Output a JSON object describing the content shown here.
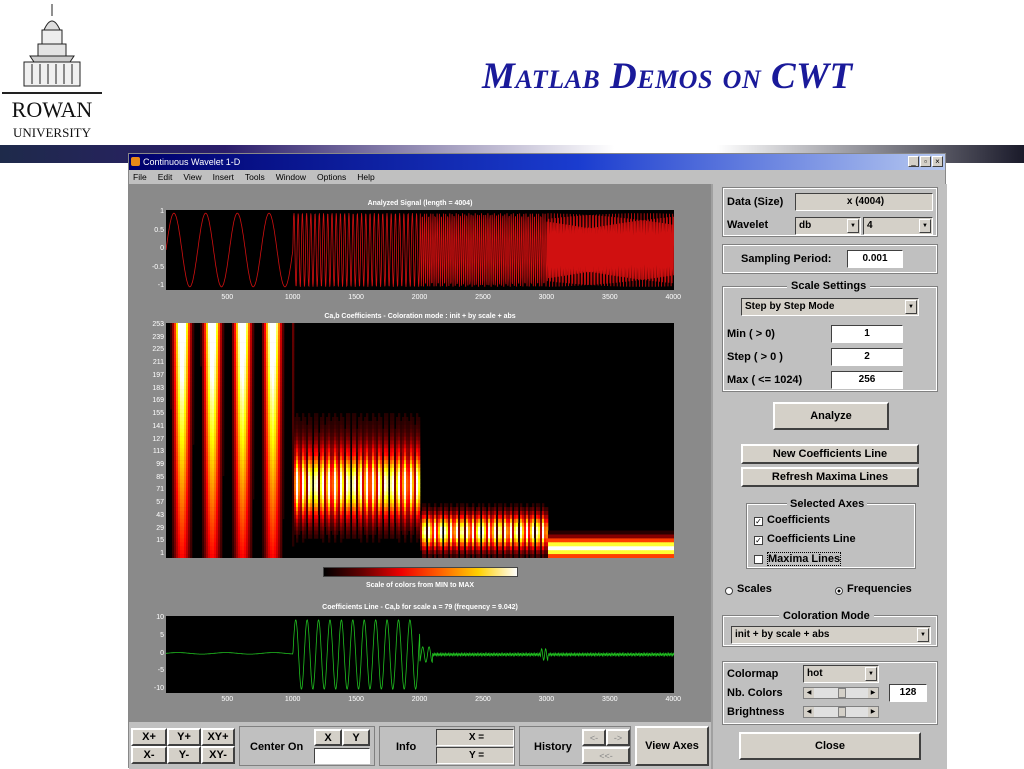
{
  "slide": {
    "title": "Matlab Demos on CWT",
    "logo_text_1": "ROWAN",
    "logo_text_2": "UNIVERSITY"
  },
  "window": {
    "title": "Continuous Wavelet 1-D",
    "menu": [
      "File",
      "Edit",
      "View",
      "Insert",
      "Tools",
      "Window",
      "Options",
      "Help"
    ]
  },
  "plots": {
    "signal": {
      "title": "Analyzed Signal  (length = 4004)",
      "yticks": [
        "1",
        "0.5",
        "0",
        "-0.5",
        "-1"
      ],
      "xticks": [
        "500",
        "1000",
        "1500",
        "2000",
        "2500",
        "3000",
        "3500",
        "4000"
      ]
    },
    "coeffs": {
      "title": "Ca,b Coefficients  - Coloration mode : init + by scale + abs",
      "yticks": [
        "253",
        "239",
        "225",
        "211",
        "197",
        "183",
        "169",
        "155",
        "141",
        "127",
        "113",
        "99",
        "85",
        "71",
        "57",
        "43",
        "29",
        "15",
        "1"
      ]
    },
    "colorbar": {
      "label": "Scale of colors from MIN to MAX"
    },
    "line": {
      "title": "Coefficients Line - Ca,b   for scale a = 79  (frequency =   9.042)",
      "yticks": [
        "10",
        "5",
        "0",
        "-5",
        "-10"
      ],
      "xticks": [
        "500",
        "1000",
        "1500",
        "2000",
        "2500",
        "3000",
        "3500",
        "4000"
      ]
    }
  },
  "panel": {
    "data_label": "Data  (Size)",
    "data_value": "x  (4004)",
    "wavelet_label": "Wavelet",
    "wavelet_family": "db",
    "wavelet_order": "4",
    "sampling_label": "Sampling Period:",
    "sampling_value": "0.001",
    "scale_settings": "Scale Settings",
    "scale_mode": "Step by Step Mode",
    "min_label": "Min  ( > 0)",
    "min_value": "1",
    "step_label": "Step  ( > 0 )",
    "step_value": "2",
    "max_label": "Max  ( <= 1024)",
    "max_value": "256",
    "analyze": "Analyze",
    "new_coef_line": "New Coefficients Line",
    "refresh_maxima": "Refresh Maxima Lines",
    "selected_axes": "Selected Axes",
    "ax_coefficients": "Coefficients",
    "ax_coef_line": "Coefficients Line",
    "ax_maxima": "Maxima Lines",
    "scales": "Scales",
    "frequencies": "Frequencies",
    "coloration_mode": "Coloration Mode",
    "coloration_value": "init + by scale + abs",
    "colormap_label": "Colormap",
    "colormap_value": "hot",
    "nb_colors_label": "Nb. Colors",
    "nb_colors_value": "128",
    "brightness_label": "Brightness",
    "close": "Close"
  },
  "bottom": {
    "xp": "X+",
    "yp": "Y+",
    "xyp": "XY+",
    "xm": "X-",
    "ym": "Y-",
    "xym": "XY-",
    "center_on": "Center On",
    "x": "X",
    "y": "Y",
    "info": "Info",
    "xeq": "X =",
    "yeq": "Y =",
    "history": "History",
    "hl": "<-",
    "hr": "->",
    "hll": "<<-",
    "view_axes": "View Axes"
  }
}
